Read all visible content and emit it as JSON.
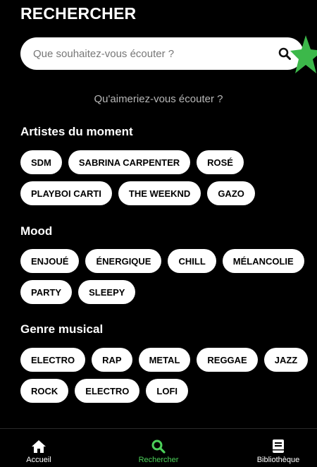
{
  "header": {
    "title": "RECHERCHER"
  },
  "search": {
    "placeholder": "Que souhaitez-vous écouter ?"
  },
  "prompt": "Qu'aimeriez-vous écouter ?",
  "sections": {
    "artists": {
      "title": "Artistes du moment",
      "chips": [
        "SDM",
        "SABRINA CARPENTER",
        "ROSÉ",
        "PLAYBOI CARTI",
        "THE WEEKND",
        "GAZO"
      ]
    },
    "mood": {
      "title": "Mood",
      "chips": [
        "ENJOUÉ",
        "ÉNERGIQUE",
        "CHILL",
        "MÉLANCOLIE",
        "PARTY",
        "SLEEPY"
      ]
    },
    "genre": {
      "title": "Genre musical",
      "chips": [
        "ELECTRO",
        "RAP",
        "METAL",
        "REGGAE",
        "JAZZ",
        "ROCK",
        "ELECTRO",
        "LOFI"
      ]
    }
  },
  "nav": {
    "items": [
      {
        "label": "Accueil",
        "icon": "home-icon"
      },
      {
        "label": "Rechercher",
        "icon": "search-icon",
        "active": true
      },
      {
        "label": "Bibliothèque",
        "icon": "book-icon"
      }
    ]
  },
  "colors": {
    "accent": "#4cd05a",
    "background": "#000000",
    "chip": "#ffffff"
  }
}
